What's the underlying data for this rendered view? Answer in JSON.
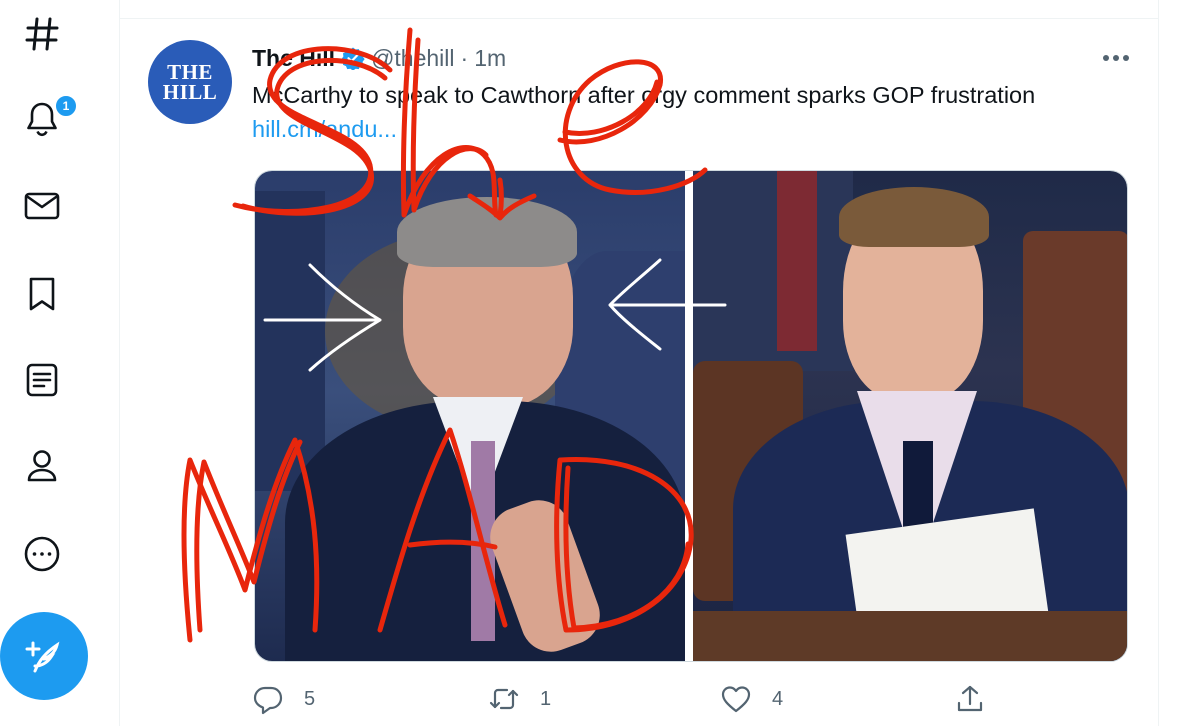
{
  "nav": {
    "items": [
      {
        "name": "explore",
        "icon": "hashtag-icon"
      },
      {
        "name": "notifications",
        "icon": "bell-icon",
        "badge": "1"
      },
      {
        "name": "messages",
        "icon": "envelope-icon"
      },
      {
        "name": "bookmarks",
        "icon": "bookmark-icon"
      },
      {
        "name": "lists",
        "icon": "list-icon"
      },
      {
        "name": "profile",
        "icon": "person-icon"
      },
      {
        "name": "more",
        "icon": "more-circle-icon"
      }
    ],
    "compose_icon": "feather-plus-icon"
  },
  "tweet": {
    "avatar": {
      "line1": "THE",
      "line2": "HILL"
    },
    "author_name": "The Hill",
    "handle": "@thehill",
    "separator": "·",
    "time": "1m",
    "text": "McCarthy to speak to Cawthorn after orgy comment sparks GOP frustration",
    "link": "hill.cm/andu...",
    "actions": {
      "reply_count": "5",
      "retweet_count": "1",
      "like_count": "4"
    }
  },
  "annotations": {
    "overlay_words": [
      "She",
      "MAD"
    ],
    "color": "#e8260c"
  },
  "colors": {
    "accent": "#1d9bf0",
    "text": "#0f1419",
    "muted": "#536471",
    "avatar_bg": "#2a5cb8"
  }
}
